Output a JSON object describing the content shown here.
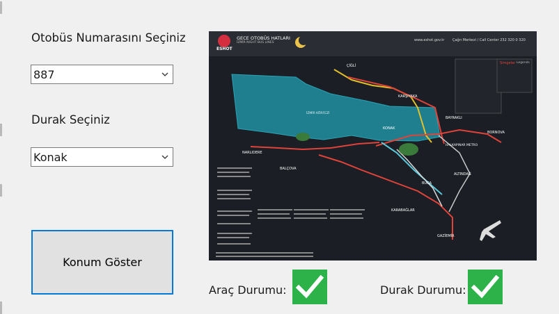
{
  "form": {
    "bus_label": "Otobüs Numarasını Seçiniz",
    "bus_value": "887",
    "stop_label": "Durak Seçiniz",
    "stop_value": "Konak",
    "show_button": "Konum Göster"
  },
  "status": {
    "vehicle_label": "Araç Durumu:",
    "stop_label": "Durak Durumu:"
  },
  "map": {
    "brand": "ESHOT",
    "title": "GECE OTOBÜS HATLARI",
    "subtitle": "İZMİR NIGHT BUS LINES",
    "website": "www.eshot.gov.tr",
    "call_center": "Çağrı Merkezi / Call Center 232 320 0 320",
    "legend_title": "Simgeler",
    "legend_sub": "Legends",
    "places": [
      "ÇİĞLİ",
      "KARŞIYAKA",
      "BAYRAKLI",
      "BORNOVA",
      "KONAK",
      "HALKAPINAR METRO",
      "NARLIDERE",
      "BALÇOVA",
      "ALTINDAĞ",
      "BUCA",
      "KARABAĞLAR",
      "GAZİEMİR",
      "İZMİR KÖRFEZİ"
    ]
  },
  "colors": {
    "check_green": "#2db24a",
    "button_border": "#0078d7"
  }
}
